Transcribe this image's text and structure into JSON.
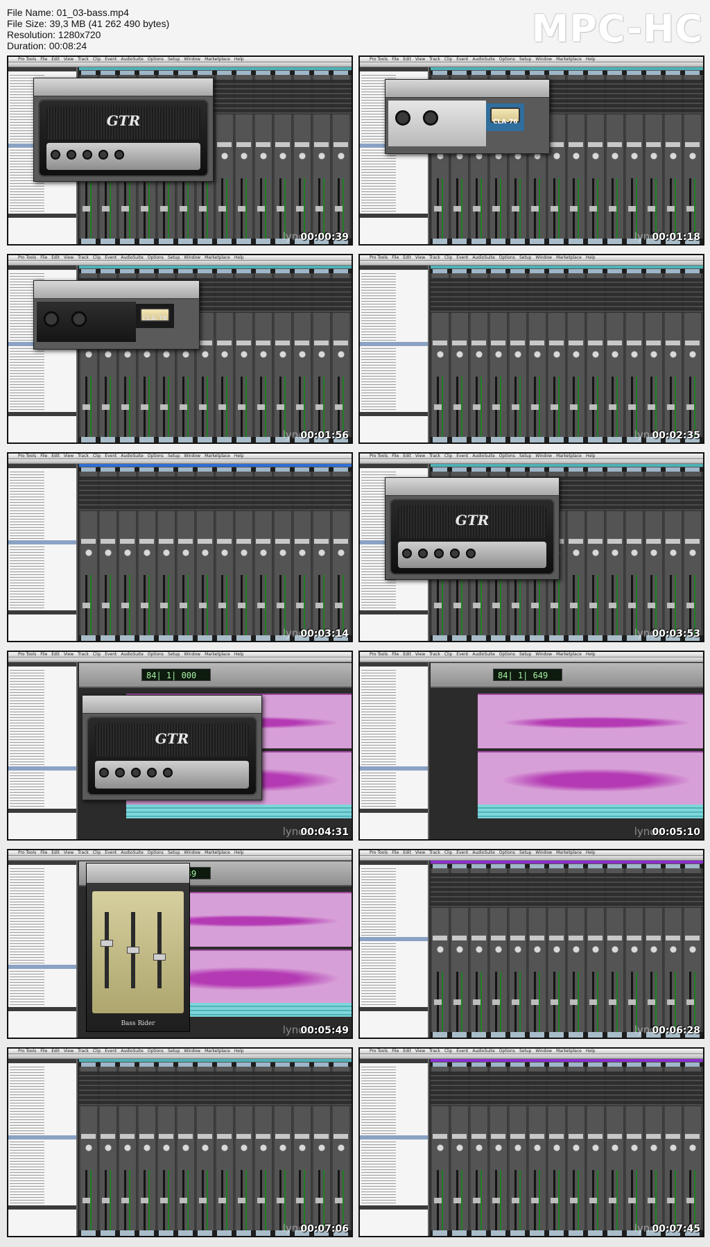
{
  "info": {
    "file_name": "File Name: 01_03-bass.mp4",
    "file_size": "File Size: 39,3 MB (41 262 490 bytes)",
    "resolution": "Resolution: 1280x720",
    "duration": "Duration: 00:08:24"
  },
  "player_logo": "MPC-HC",
  "watermark": "lynda",
  "menu": [
    "Pro Tools",
    "File",
    "Edit",
    "View",
    "Track",
    "Clip",
    "Event",
    "AudioSuite",
    "Options",
    "Setup",
    "Window",
    "Marketplace",
    "Help"
  ],
  "thumbnails": [
    {
      "timestamp": "00:00:39",
      "view": "mix",
      "plugin": "gtr"
    },
    {
      "timestamp": "00:01:18",
      "view": "mix",
      "plugin": "cla-light"
    },
    {
      "timestamp": "00:01:56",
      "view": "mix",
      "plugin": "cla-dark"
    },
    {
      "timestamp": "00:02:35",
      "view": "mix",
      "plugin": "none"
    },
    {
      "timestamp": "00:03:14",
      "view": "mix-blue",
      "plugin": "none"
    },
    {
      "timestamp": "00:03:53",
      "view": "mix",
      "plugin": "gtr"
    },
    {
      "timestamp": "00:04:31",
      "view": "edit",
      "plugin": "gtr"
    },
    {
      "timestamp": "00:05:10",
      "view": "edit",
      "plugin": "none"
    },
    {
      "timestamp": "00:05:49",
      "view": "edit",
      "plugin": "bass-rider"
    },
    {
      "timestamp": "00:06:28",
      "view": "mix-purple",
      "plugin": "none"
    },
    {
      "timestamp": "00:07:06",
      "view": "mix",
      "plugin": "none"
    },
    {
      "timestamp": "00:07:45",
      "view": "mix-purple",
      "plugin": "none"
    }
  ],
  "plugins": {
    "gtr_logo": "GTR",
    "cla_label": "CLA-76",
    "bass_rider_label": "Bass Rider"
  },
  "counters": {
    "edit_1": "84| 1| 000",
    "edit_2": "84| 1| 649"
  },
  "colors": {
    "accent_teal": "#4fb3b8",
    "accent_purple": "#8d2fd0",
    "clip_pink": "#d79fd7",
    "meter_green": "#1f7f24",
    "selection_blue": "#8aa2c4"
  }
}
